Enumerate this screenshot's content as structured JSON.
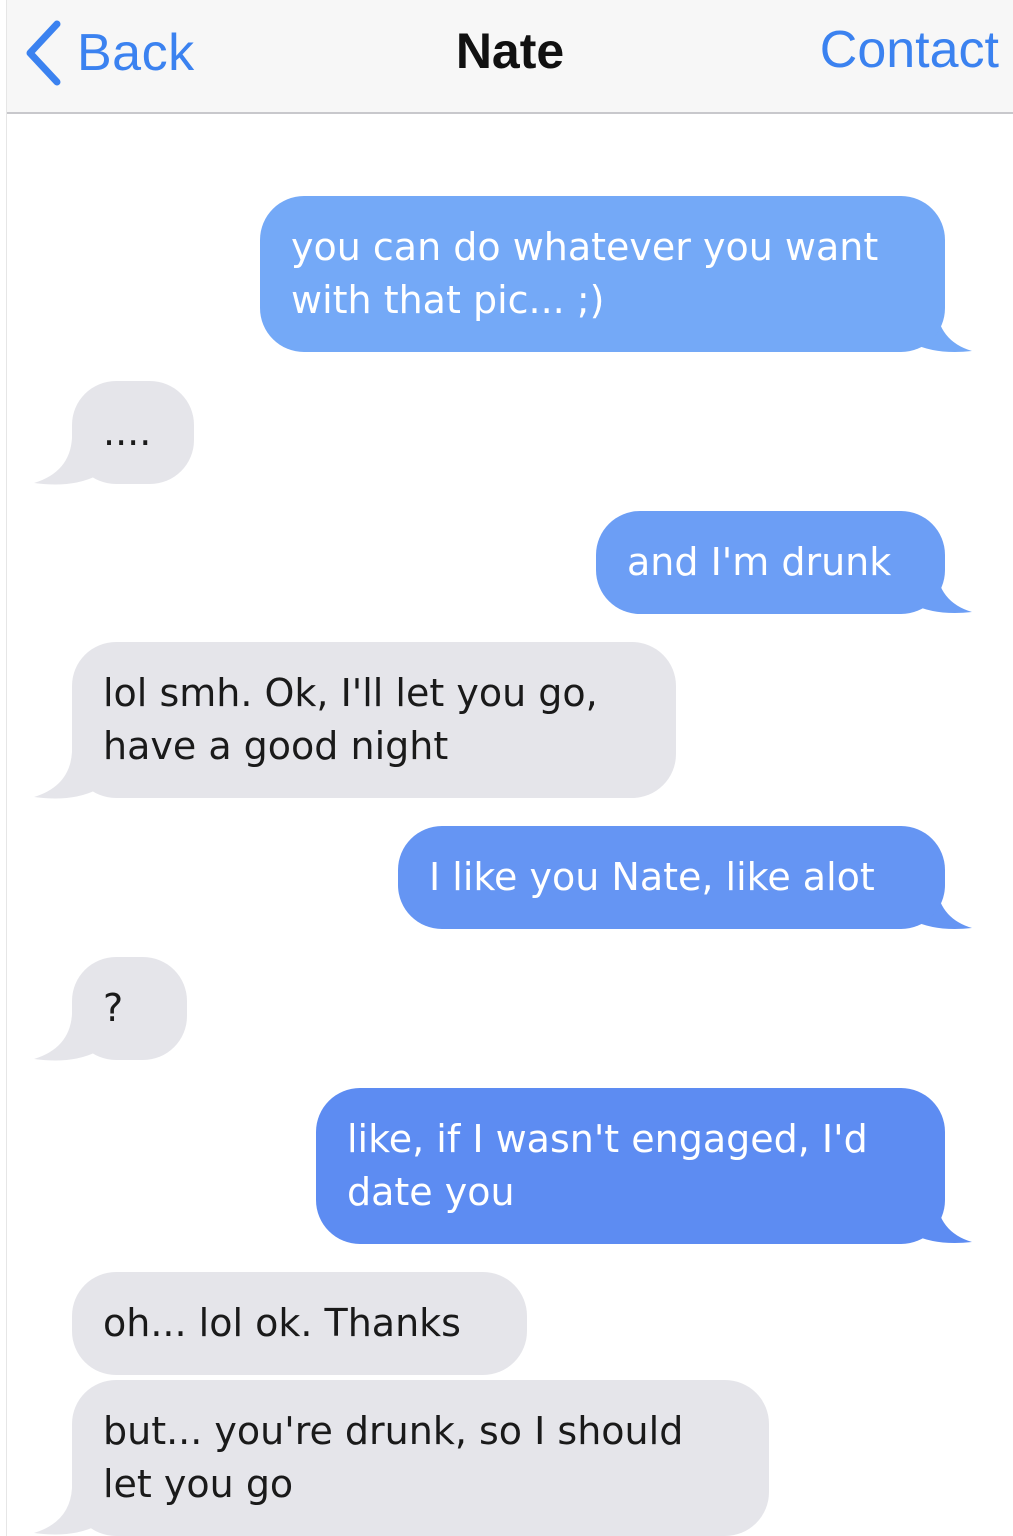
{
  "header": {
    "back_label": "Back",
    "title": "Nate",
    "contact_label": "Contact",
    "back_icon": "chevron-left-icon"
  },
  "colors": {
    "accent": "#3b82f0",
    "received_bubble": "#e5e5ea",
    "sent_bubble_1": "#74a9f7",
    "sent_bubble_2": "#6c9ef5",
    "sent_bubble_3": "#6595f3",
    "sent_bubble_4": "#5d8cf2"
  },
  "messages": [
    {
      "direction": "sent",
      "text": "you can do whatever you want\nwith that pic... ;)"
    },
    {
      "direction": "received",
      "text": "...."
    },
    {
      "direction": "sent",
      "text": "and I'm drunk"
    },
    {
      "direction": "received",
      "text": "lol smh. Ok, I'll let you go,\nhave a good night"
    },
    {
      "direction": "sent",
      "text": "I like you Nate, like alot"
    },
    {
      "direction": "received",
      "text": "?"
    },
    {
      "direction": "sent",
      "text": "like, if I wasn't engaged, I'd\ndate you"
    },
    {
      "direction": "received",
      "text": "oh... lol ok. Thanks"
    },
    {
      "direction": "received",
      "text": "but... you're drunk, so I should\nlet you go"
    }
  ]
}
